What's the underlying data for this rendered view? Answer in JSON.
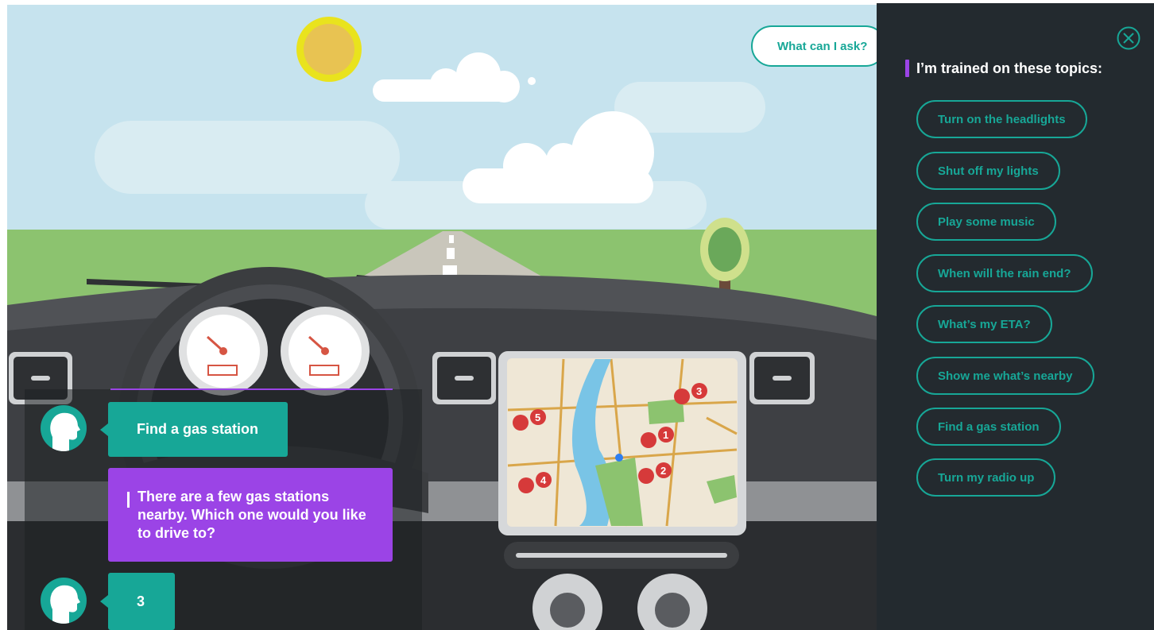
{
  "header": {
    "ask_button_label": "What can I ask?"
  },
  "chat": {
    "messages": [
      {
        "from": "user",
        "text": "Find a gas station"
      },
      {
        "from": "bot",
        "text": "There are a few gas stations nearby. Which one would you like to drive to?"
      },
      {
        "from": "user",
        "text": "3"
      }
    ]
  },
  "map": {
    "markers": [
      "1",
      "2",
      "3",
      "4",
      "5"
    ]
  },
  "panel": {
    "title": "I’m trained on these topics:",
    "close_icon": "close-circle-icon",
    "topics": [
      "Turn on the headlights",
      "Shut off my lights",
      "Play some music",
      "When will the rain end?",
      "What’s my ETA?",
      "Show me what’s nearby",
      "Find a gas station",
      "Turn my radio up"
    ]
  },
  "colors": {
    "accent_teal": "#17a797",
    "accent_purple": "#9b44e6",
    "panel_bg": "#232a2f"
  }
}
